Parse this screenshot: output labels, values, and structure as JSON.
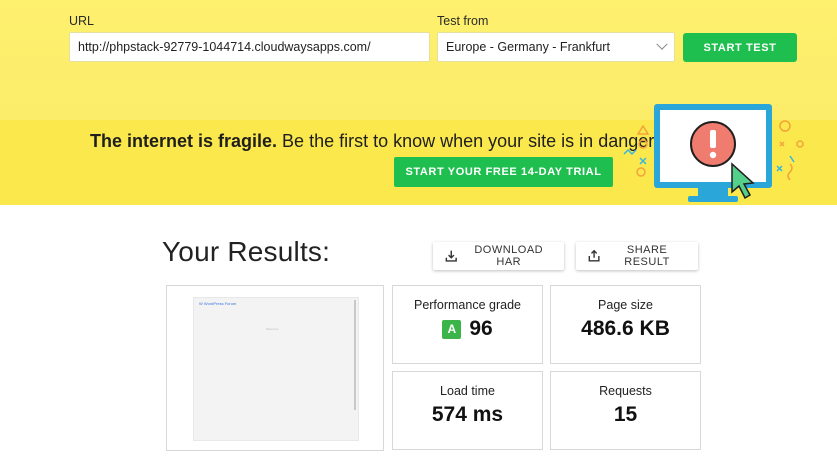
{
  "form": {
    "url_label": "URL",
    "url_value": "http://phpstack-92779-1044714.cloudwaysapps.com/",
    "location_label": "Test from",
    "location_value": "Europe - Germany - Frankfurt",
    "start_label": "START TEST"
  },
  "promo": {
    "headline_bold": "The internet is fragile.",
    "headline_rest": " Be the first to know when your site is in danger.",
    "trial_label": "START YOUR FREE 14-DAY TRIAL"
  },
  "results": {
    "title": "Your Results:",
    "download_label": "DOWNLOAD HAR",
    "share_label": "SHARE RESULT",
    "thumbnail": {
      "page_title": "W  WordPress Forum",
      "page_text": "Welcome"
    },
    "metrics": {
      "grade_label": "Performance grade",
      "grade_letter": "A",
      "grade_score": "96",
      "page_size_label": "Page size",
      "page_size_value": "486.6 KB",
      "load_time_label": "Load time",
      "load_time_value": "574 ms",
      "requests_label": "Requests",
      "requests_value": "15"
    }
  },
  "colors": {
    "top_band": "#fef16e",
    "promo_band": "#fbe84c",
    "accent_green": "#1fbf4f",
    "grade_green": "#3bb54a"
  }
}
